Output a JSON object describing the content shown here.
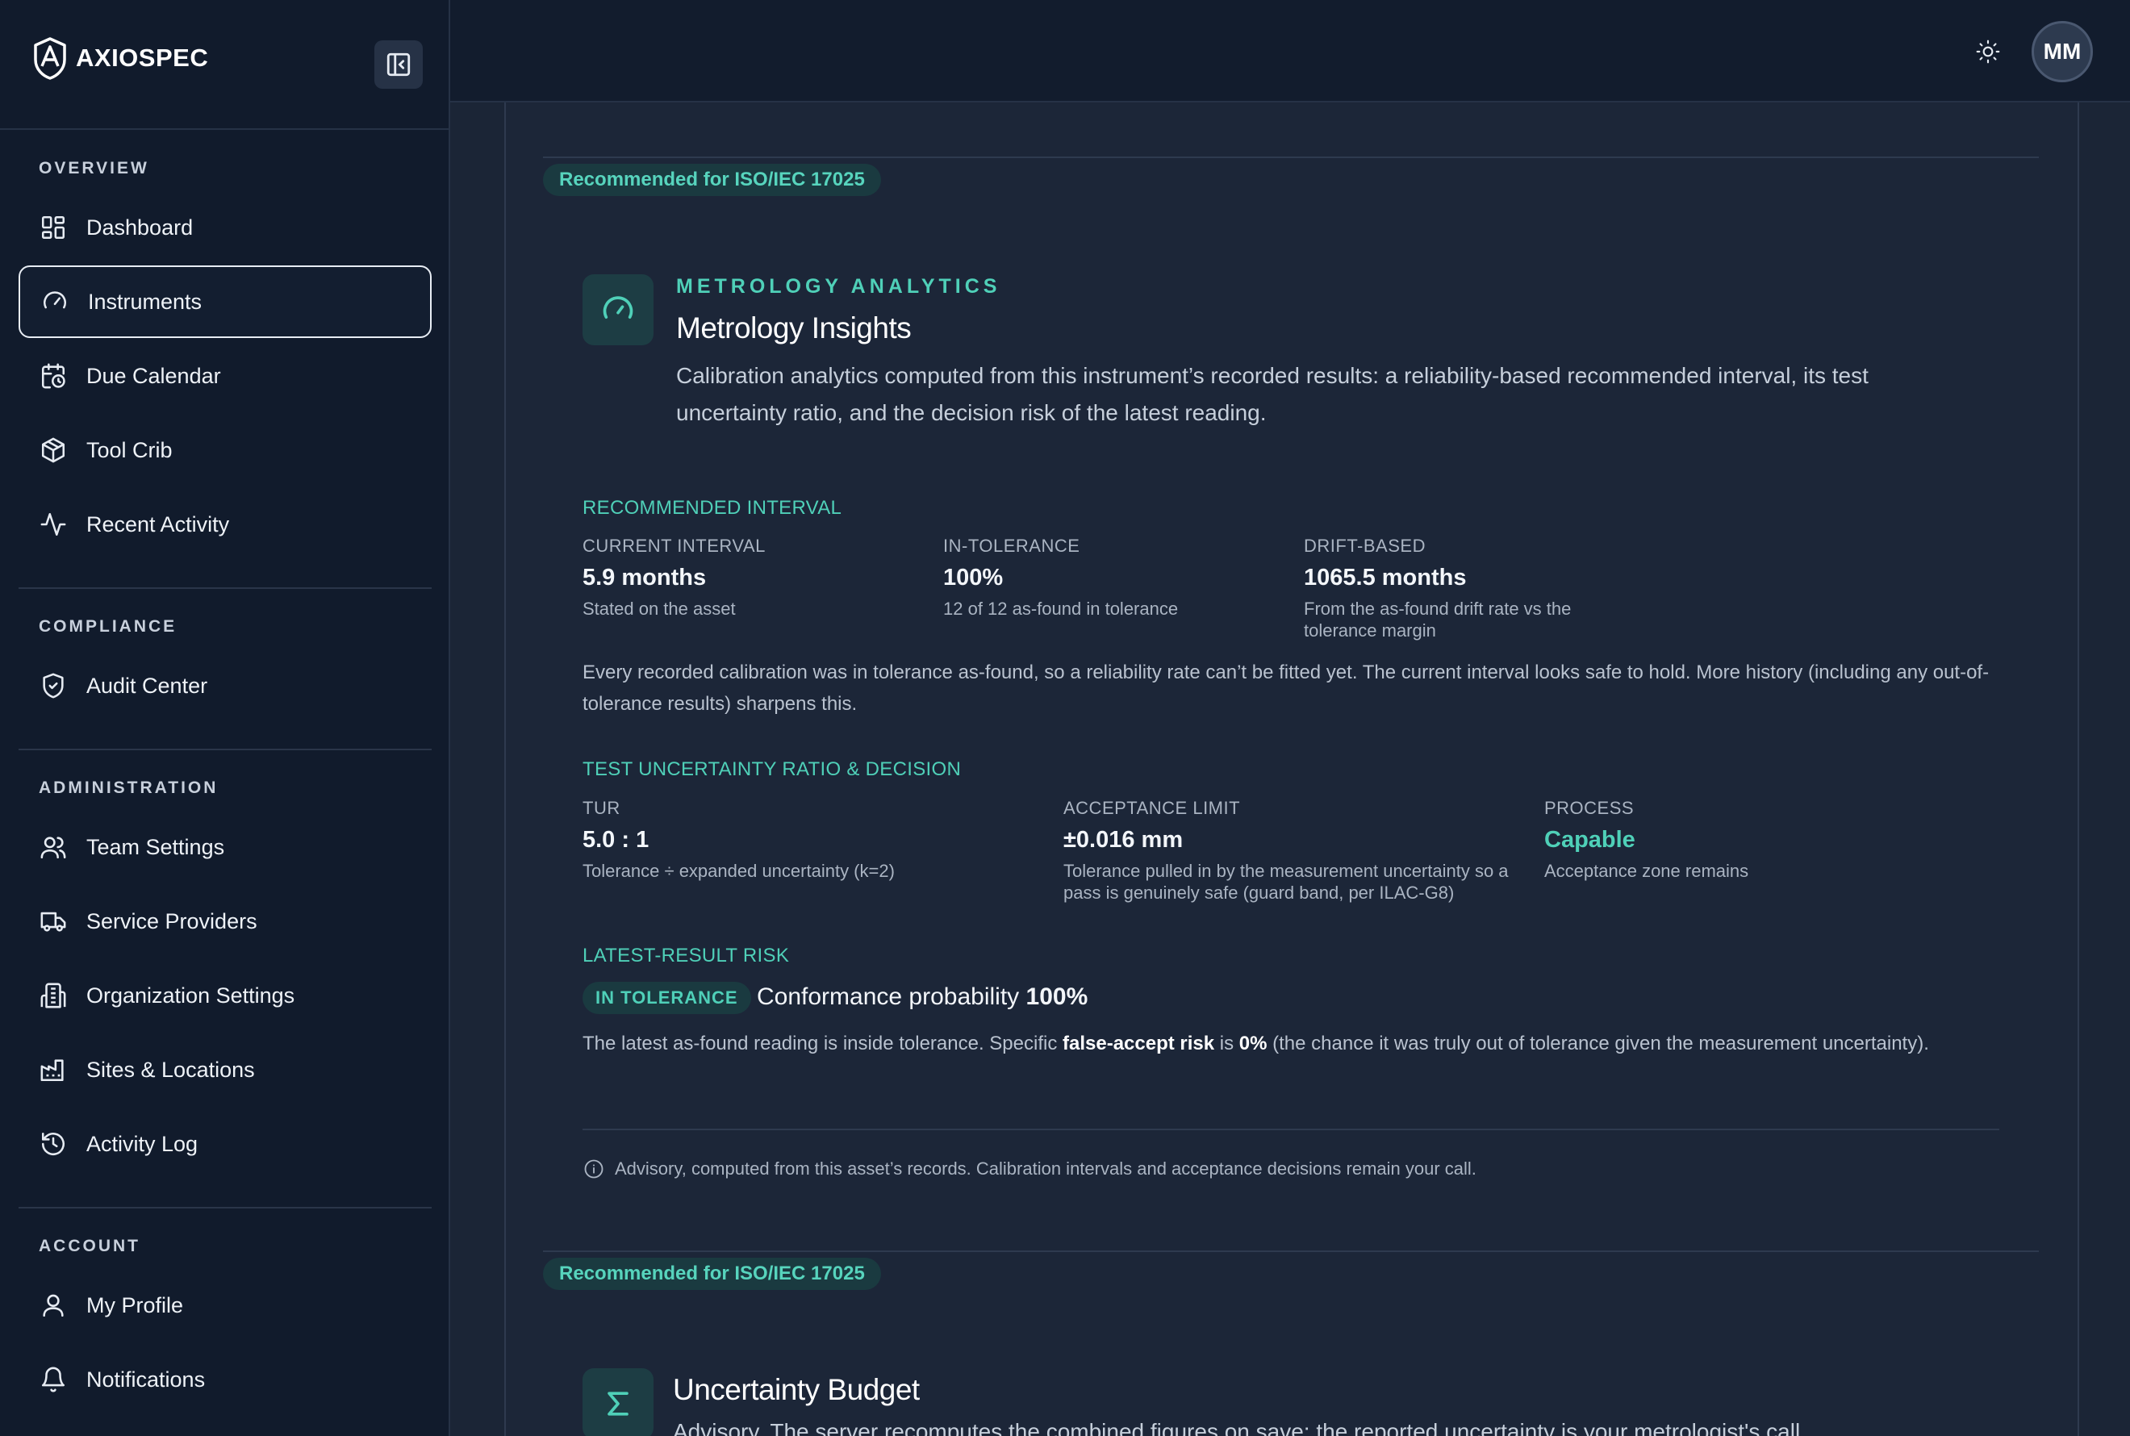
{
  "brand": {
    "name": "AXIOSPEC"
  },
  "sidebar": {
    "sections": [
      {
        "heading": "OVERVIEW"
      },
      {
        "heading": "COMPLIANCE"
      },
      {
        "heading": "ADMINISTRATION"
      },
      {
        "heading": "ACCOUNT"
      }
    ],
    "items": [
      {
        "label": "Dashboard",
        "icon": "dashboard-icon"
      },
      {
        "label": "Instruments",
        "icon": "gauge-icon",
        "active": true
      },
      {
        "label": "Due Calendar",
        "icon": "calendar-clock-icon"
      },
      {
        "label": "Tool Crib",
        "icon": "box-icon"
      },
      {
        "label": "Recent Activity",
        "icon": "activity-icon"
      },
      {
        "label": "Audit Center",
        "icon": "shield-check-icon"
      },
      {
        "label": "Team Settings",
        "icon": "users-icon"
      },
      {
        "label": "Service Providers",
        "icon": "truck-icon"
      },
      {
        "label": "Organization Settings",
        "icon": "building-icon"
      },
      {
        "label": "Sites & Locations",
        "icon": "factory-icon"
      },
      {
        "label": "Activity Log",
        "icon": "history-icon"
      },
      {
        "label": "My Profile",
        "icon": "user-icon"
      },
      {
        "label": "Notifications",
        "icon": "bell-icon"
      }
    ]
  },
  "topbar": {
    "avatar_initials": "MM",
    "theme_icon": "sun-icon"
  },
  "insights": {
    "badge": "Recommended for ISO/IEC 17025",
    "kicker": "METROLOGY ANALYTICS",
    "title": "Metrology Insights",
    "description": "Calibration analytics computed from this instrument’s recorded results: a reliability-based recommended interval, its test uncertainty ratio, and the decision risk of the latest reading.",
    "interval": {
      "label": "RECOMMENDED INTERVAL",
      "stats": [
        {
          "key": "CURRENT INTERVAL",
          "value": "5.9 months",
          "sub": "Stated on the asset"
        },
        {
          "key": "IN-TOLERANCE",
          "value": "100%",
          "sub": "12 of 12 as-found in tolerance"
        },
        {
          "key": "DRIFT-BASED",
          "value": "1065.5 months",
          "sub": "From the as-found drift rate vs the tolerance margin"
        }
      ],
      "note": "Every recorded calibration was in tolerance as-found, so a reliability rate can’t be fitted yet. The current interval looks safe to hold. More history (including any out-of-tolerance results) sharpens this."
    },
    "tur": {
      "label": "TEST UNCERTAINTY RATIO & DECISION",
      "stats": [
        {
          "key": "TUR",
          "value": "5.0 : 1",
          "sub": "Tolerance ÷ expanded uncertainty (k=2)"
        },
        {
          "key": "ACCEPTANCE LIMIT",
          "value": "±0.016 mm",
          "sub": "Tolerance pulled in by the measurement uncertainty so a pass is genuinely safe (guard band, per ILAC-G8)"
        },
        {
          "key": "PROCESS",
          "value": "Capable",
          "sub": "Acceptance zone remains"
        }
      ]
    },
    "risk": {
      "label": "LATEST-RESULT RISK",
      "status": "IN TOLERANCE",
      "conf_prefix": "Conformance probability ",
      "conf_value": "100%",
      "text_1": "The latest as-found reading is inside tolerance. Specific ",
      "text_bold_1": "false-accept risk",
      "text_2": " is ",
      "text_bold_2": "0%",
      "text_3": " (the chance it was truly out of tolerance given the measurement uncertainty)."
    },
    "advisory": "Advisory, computed from this asset’s records. Calibration intervals and acceptance decisions remain your call."
  },
  "budget": {
    "badge": "Recommended for ISO/IEC 17025",
    "title": "Uncertainty Budget",
    "description": "Advisory. The server recomputes the combined figures on save; the reported uncertainty is your metrologist's call."
  }
}
